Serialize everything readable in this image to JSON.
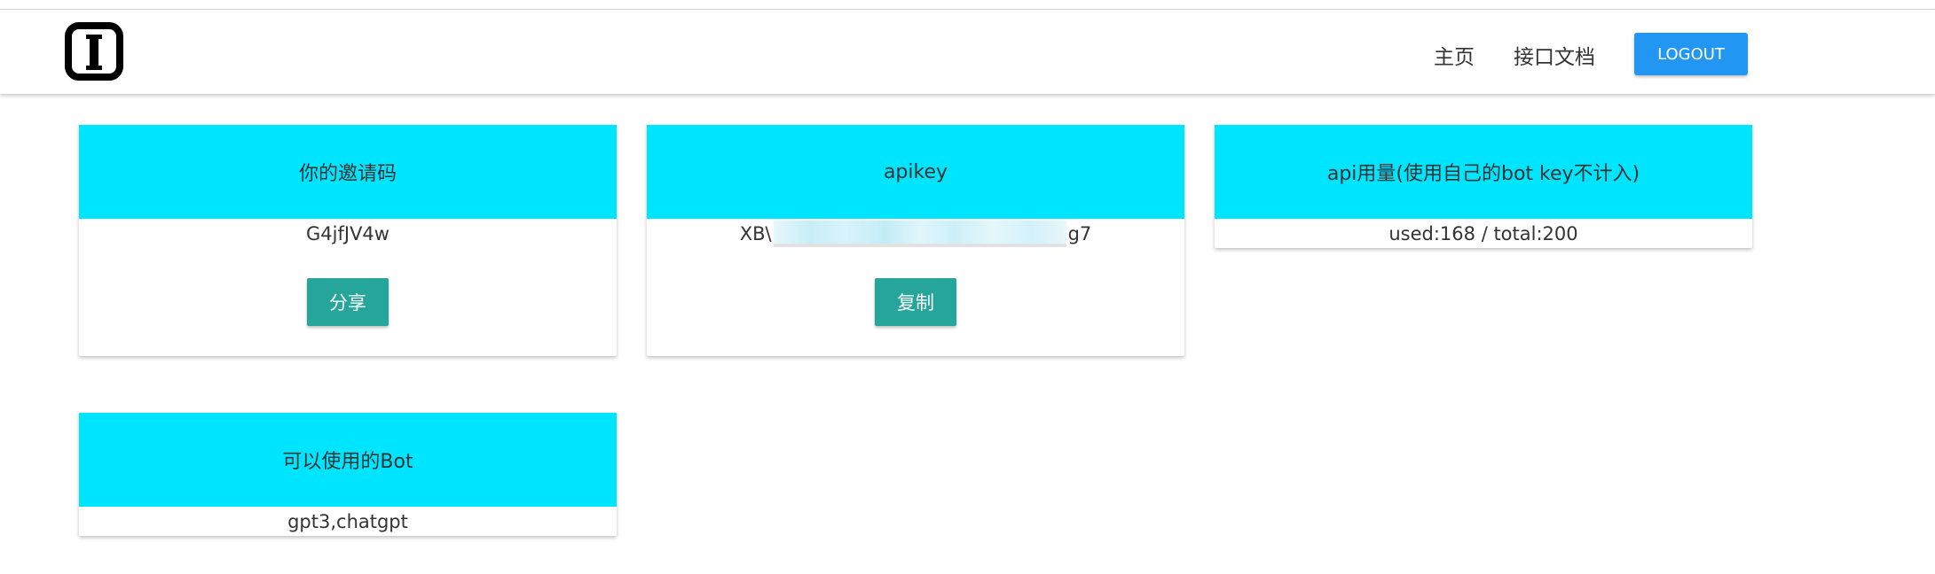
{
  "nav": {
    "home": "主页",
    "docs": "接口文档",
    "logout": "LOGOUT"
  },
  "cards": {
    "invite": {
      "title": "你的邀请码",
      "value": "G4jfJV4w",
      "button": "分享"
    },
    "apikey": {
      "title": "apikey",
      "value_prefix": "XB\\",
      "value_suffix": "g7",
      "button": "复制"
    },
    "usage": {
      "title": "api用量(使用自己的bot key不计入)",
      "value": "used:168 / total:200"
    },
    "bots": {
      "title": "可以使用的Bot",
      "value": "gpt3,chatgpt"
    }
  },
  "colors": {
    "card_header": "#00e5ff",
    "logout_button": "#2196f3",
    "action_button": "#26a69a"
  }
}
